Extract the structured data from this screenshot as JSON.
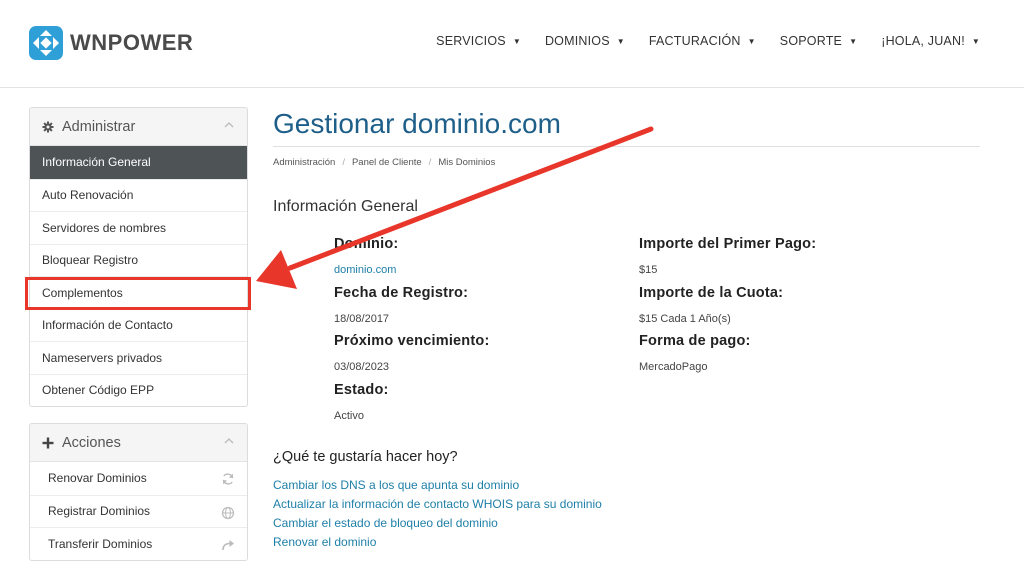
{
  "brand": {
    "name": "WNPOWER"
  },
  "nav": {
    "items": [
      {
        "label": "SERVICIOS"
      },
      {
        "label": "DOMINIOS"
      },
      {
        "label": "FACTURACIÓN"
      },
      {
        "label": "SOPORTE"
      },
      {
        "label": "¡HOLA, JUAN!"
      }
    ]
  },
  "sidebar": {
    "manage": {
      "title": "Administrar",
      "items": [
        {
          "label": "Información General"
        },
        {
          "label": "Auto Renovación"
        },
        {
          "label": "Servidores de nombres"
        },
        {
          "label": "Bloquear Registro"
        },
        {
          "label": "Complementos"
        },
        {
          "label": "Información de Contacto"
        },
        {
          "label": "Nameservers privados"
        },
        {
          "label": "Obtener Código EPP"
        }
      ]
    },
    "actions": {
      "title": "Acciones",
      "items": [
        {
          "label": "Renovar Dominios",
          "icon": "refresh-icon"
        },
        {
          "label": "Registrar Dominios",
          "icon": "globe-icon"
        },
        {
          "label": "Transferir Dominios",
          "icon": "share-arrow-icon"
        }
      ]
    }
  },
  "main": {
    "title": "Gestionar dominio.com",
    "breadcrumb": [
      "Administración",
      "Panel de Cliente",
      "Mis Dominios"
    ],
    "section_title": "Información General",
    "left_col": [
      {
        "label": "Dominio:",
        "value": "dominio.com"
      },
      {
        "label": "Fecha de Registro:",
        "value": "18/08/2017"
      },
      {
        "label": "Próximo vencimiento:",
        "value": "03/08/2023"
      },
      {
        "label": "Estado:",
        "value": "Activo"
      }
    ],
    "right_col": [
      {
        "label": "Importe del Primer Pago:",
        "value": "$15"
      },
      {
        "label": "Importe de la Cuota:",
        "value": "$15 Cada 1 Año(s)"
      },
      {
        "label": "Forma de pago:",
        "value": "MercadoPago"
      }
    ],
    "question": "¿Qué te gustaría hacer hoy?",
    "links": [
      "Cambiar los DNS a los que apunta su dominio",
      "Actualizar la información de contacto WHOIS para su dominio",
      "Cambiar el estado de bloqueo del dominio",
      "Renovar el dominio"
    ]
  },
  "colors": {
    "brand_blue": "#2f9fd8",
    "link": "#1e7fa8",
    "title": "#1e5f8a",
    "active_item": "#4e5356",
    "annotation_red": "#e8362a"
  }
}
